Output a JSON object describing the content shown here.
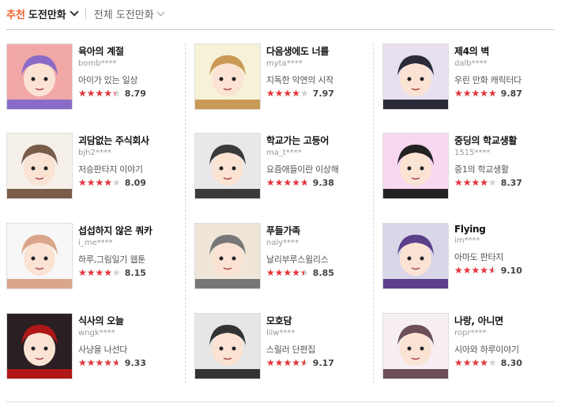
{
  "header": {
    "rec_accent": "추천",
    "rec_main": "도전만화",
    "all_label": "전체 도전만화"
  },
  "colors": {
    "accent": "#f0602b",
    "star": "#e5343a"
  },
  "comics": [
    {
      "title": "육아의 계절",
      "author": "bomb****",
      "desc": "아이가 있는 일상",
      "score": "8.79",
      "rating": 4.4,
      "thumb_bg": "#f2a7a7",
      "thumb_fg": "#8a6bc7"
    },
    {
      "title": "다음생에도 너를",
      "author": "myta****",
      "desc": "지독한 악연의 시작",
      "score": "7.97",
      "rating": 4.0,
      "thumb_bg": "#f6f2d8",
      "thumb_fg": "#c99a55"
    },
    {
      "title": "제4의 벽",
      "author": "dalb****",
      "desc": "우린 만화 캐릭터다",
      "score": "9.87",
      "rating": 4.95,
      "thumb_bg": "#e8e0ef",
      "thumb_fg": "#2a2a3a"
    },
    {
      "title": "괴담없는 주식회사",
      "author": "bjh2****",
      "desc": "저승판타지 이야기",
      "score": "8.09",
      "rating": 4.05,
      "thumb_bg": "#f5f0ea",
      "thumb_fg": "#7a5c4a"
    },
    {
      "title": "학교가는 고등어",
      "author": "ma_t****",
      "desc": "요즘애들이란 이상해",
      "score": "9.38",
      "rating": 4.7,
      "thumb_bg": "#e8e8e8",
      "thumb_fg": "#3a3a3a"
    },
    {
      "title": "중딩의 학교생활",
      "author": "1515****",
      "desc": "중1의 학교생활",
      "score": "8.37",
      "rating": 4.2,
      "thumb_bg": "#f7d8f0",
      "thumb_fg": "#222222"
    },
    {
      "title": "섭섭하지 않은 쿼카",
      "author": "i_me****",
      "desc": "하루,그림일기 웹툰",
      "score": "8.15",
      "rating": 4.1,
      "thumb_bg": "#f7f7f7",
      "thumb_fg": "#d9a68a"
    },
    {
      "title": "푸들가족",
      "author": "naly****",
      "desc": "날리부루스윌리스",
      "score": "8.85",
      "rating": 4.45,
      "thumb_bg": "#efe6d8",
      "thumb_fg": "#777777"
    },
    {
      "title": "Flying",
      "author": "im****",
      "desc": "아마도 판타지",
      "score": "9.10",
      "rating": 4.55,
      "thumb_bg": "#d8d6e8",
      "thumb_fg": "#5b3f8a"
    },
    {
      "title": "식사의 오늘",
      "author": "wngk****",
      "desc": "사냥을 나선다",
      "score": "9.33",
      "rating": 4.65,
      "thumb_bg": "#2a1f22",
      "thumb_fg": "#b01818"
    },
    {
      "title": "모호담",
      "author": "lilw****",
      "desc": "스릴러 단편집",
      "score": "9.17",
      "rating": 4.6,
      "thumb_bg": "#e6e6e6",
      "thumb_fg": "#333333"
    },
    {
      "title": "나랑, 아니면",
      "author": "ropr****",
      "desc": "시아와 하루이야기",
      "score": "8.30",
      "rating": 4.15,
      "thumb_bg": "#f6eef0",
      "thumb_fg": "#6b4e58"
    }
  ]
}
